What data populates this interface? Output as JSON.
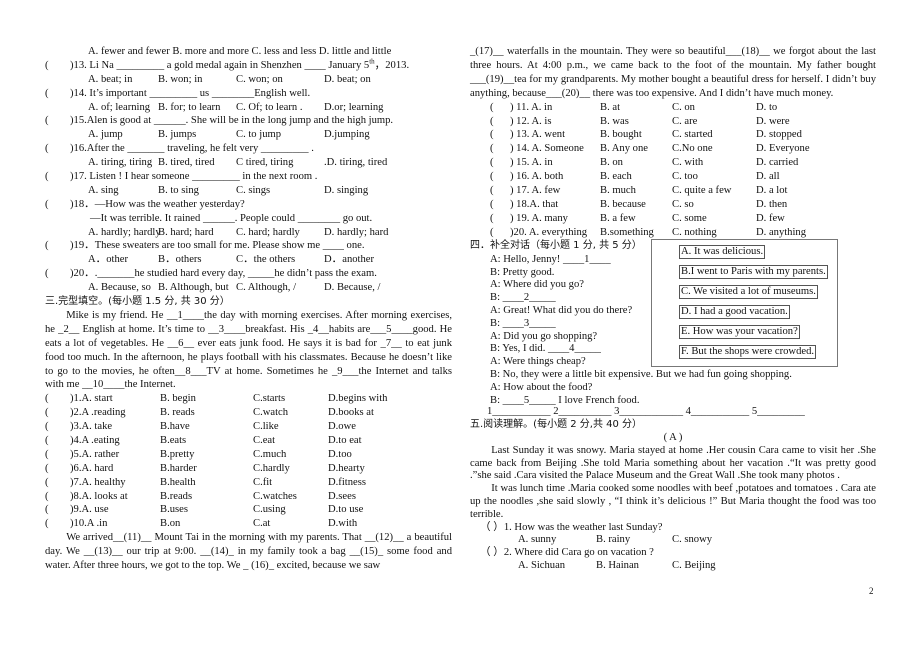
{
  "left": {
    "q12_options": "A. fewer and fewer B. more and more C. less and less D. little and little",
    "mcq": [
      {
        "paren": "(",
        "q": ")13. Li Na _________ a gold medal again in Shenzhen ____ January 5",
        "sup": "th",
        "q_after": "，2013.",
        "options": [
          "A. beat; in",
          "B. won; in",
          "C. won; on",
          "D. beat; on"
        ]
      },
      {
        "paren": "(",
        "q": ")14. It’s important _________ us ________English well.",
        "options": [
          "A. of; learning",
          "B. for; to learn",
          "C. Of; to learn .",
          "D.or; learning"
        ]
      },
      {
        "paren": "(",
        "q": ")15.Alen is good at ______. She will be in the long jump and the high jump.",
        "options": [
          "A. jump",
          "B. jumps",
          "C. to jump",
          "D.jumping"
        ]
      },
      {
        "paren": "(",
        "q": ")16.After the _______ traveling, he felt very _________ .",
        "options": [
          "A. tiring, tiring",
          "B. tired, tired",
          "C tired, tiring",
          ".D. tiring, tired"
        ]
      },
      {
        "paren": "(",
        "q": ")17. Listen ! I hear someone _________ in the next room .",
        "options": [
          "A. sing",
          "B. to sing",
          "C. sings",
          "D. singing"
        ]
      },
      {
        "paren": "(",
        "q": ")18．—How was the weather yesterday?",
        "sub": "—It was terrible. It rained ______. People could ________  go out.",
        "options": [
          "A. hardly; hardly",
          "B. hard; hard",
          "C. hard; hardly",
          "D. hardly; hard"
        ]
      },
      {
        "paren": "(",
        "q": ")19．These sweaters are too small for me. Please show me ____ one.",
        "options": [
          "A．other",
          "B．others",
          "C．the others",
          "D．another"
        ]
      },
      {
        "paren": "(",
        "q": ")20．._______he studied hard every day,  _____he didn’t pass the exam.",
        "options": [
          "A. Because, so",
          "B. Although, but",
          "C. Although, /",
          "D. Because, /"
        ]
      }
    ],
    "section3_title": "三.完型填空。(每小题 1.5 分, 共 30 分）",
    "passage1": "Mike is my friend. He __1____the day with morning exercises. After morning exercises, he _2__ English at home. It’s time to __3____breakfast. His _4__habits are___5____good. He eats a lot of vegetables. He __6__ ever eats junk food. He says it is bad for _7__ to eat junk food too much. In the afternoon, he plays football with his classmates. Because he doesn’t like to go to the movies, he often__8___TV at home. Sometimes he _9___the Internet and talks with me __10____the Internet.",
    "cloze1": [
      [
        "(",
        ")1.A. start",
        "B. begin",
        "C.starts",
        "D.begins with"
      ],
      [
        "(",
        ")2.A .reading",
        "B. reads",
        "C.watch",
        "D.books at"
      ],
      [
        "(",
        ")3.A. take",
        "B.have",
        "C.like",
        "D.owe"
      ],
      [
        "(",
        ")4.A .eating",
        "B.eats",
        "C.eat",
        "D.to eat"
      ],
      [
        "(",
        ")5.A. rather",
        "B.pretty",
        "C.much",
        "D.too"
      ],
      [
        "(",
        ")6.A. hard",
        "B.harder",
        "C.hardly",
        "D.hearty"
      ],
      [
        "(",
        ")7.A. healthy",
        "B.health",
        "C.fit",
        "D.fitness"
      ],
      [
        "(",
        ")8.A. looks at",
        "B.reads",
        "C.watches",
        "D.sees"
      ],
      [
        "(",
        ")9.A. use",
        "B.uses",
        "C.using",
        "D.to use"
      ],
      [
        "(",
        ")10.A .in",
        "B.on",
        "C.at",
        "D.with"
      ]
    ],
    "passage2_start": "We arrived__(11)__ Mount Tai in the morning with my parents. That __(12)__ a beautiful day. We __(13)__ our trip at 9:00. __(14)_ in my family took a bag __(15)_ some food and water. After three hours, we got to the top. We _ (16)_ excited, because we saw"
  },
  "right": {
    "passage2_end": "_(17)__ waterfalls in the mountain. They were so beautiful___(18)__ we forgot about the last three hours. At 4:00 p.m., we came back to the foot of the mountain. My father bought ___(19)__tea for my grandparents. My mother bought a beautiful dress for herself. I didn’t buy anything, because___(20)__ there was too expensive. And I didn’t have much money.",
    "cloze2": [
      [
        "(",
        ") 11. A. in",
        "B. at",
        "C. on",
        "D. to"
      ],
      [
        "(",
        ") 12. A. is",
        "B. was",
        "C. are",
        "D. were"
      ],
      [
        "(",
        ") 13. A. went",
        "B. bought",
        "C. started",
        "D. stopped"
      ],
      [
        "(",
        ") 14. A. Someone",
        "B. Any one",
        "C.No one",
        "D. Everyone"
      ],
      [
        "(",
        ") 15. A. in",
        "B. on",
        "C. with",
        "D. carried"
      ],
      [
        "(",
        ") 16. A. both",
        "B. each",
        "C. too",
        "D. all"
      ],
      [
        "(",
        ") 17. A. few",
        "B. much",
        "C. quite a few",
        "D. a lot"
      ],
      [
        "(",
        ") 18.A. that",
        "B. because",
        "C. so",
        "D. then"
      ],
      [
        "(",
        ") 19. A. many",
        "B. a few",
        "C. some",
        "D. few"
      ],
      [
        "(",
        ")20. A. everything",
        "B.something",
        "C. nothing",
        "D. anything"
      ]
    ],
    "section4_title": "四．补全对话（每小题 1 分, 共 5 分）",
    "dialogue": [
      "A: Hello, Jenny!  ____1____",
      "B: Pretty good.",
      "A: Where did you go?",
      "B:  ____2_____",
      "A: Great! What did you do there?",
      "B:  ____3_____",
      "A: Did you go shopping?",
      "B: Yes, I did.  ____4_____",
      "A: Were things cheap?",
      "B: No, they were a little bit expensive. But we had fun going shopping.",
      "A: How about the food?",
      "B:  ____5_____  I love French food."
    ],
    "choices": [
      "A. It was delicious.",
      "B.I went to Paris with my parents.",
      "C. We visited a lot of museums.",
      "D. I had a good vacation.",
      "E. How was your vacation?",
      "F. But the shops were crowded."
    ],
    "answer_line": "1___________    2__________    3____________    4___________    5_________",
    "section5_title": "五.阅读理解。(每小题 2 分,共 40 分）",
    "part_a": "( A )",
    "reading_p1": "Last Sunday it was snowy. Maria stayed at home .Her cousin Cara came to visit her .She came back from Beijing .She told Maria something about her vacation .“It was pretty good .”she said .Cara visited the Palace Museum and the Great Wall .She took many photos .",
    "reading_p2": "It was lunch time .Maria cooked some noodles with beef ,potatoes and tomatoes . Cara ate up the noodles ,she said slowly , “I think it’s delicious !” But Maria thought the food was too terrible.",
    "reading_qs": [
      {
        "q": "（        ）1. How was the weather last Sunday?",
        "options": [
          "A. sunny",
          "B. rainy",
          "C. snowy"
        ]
      },
      {
        "q": "（        ）2. Where did Cara go on vacation ?",
        "options": [
          "A. Sichuan",
          "B. Hainan",
          "C. Beijing"
        ]
      }
    ]
  },
  "page_number": "2"
}
